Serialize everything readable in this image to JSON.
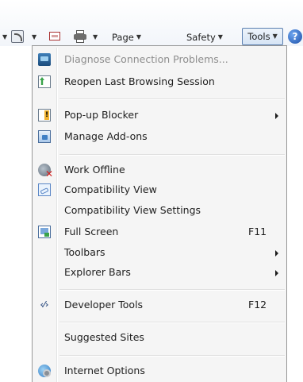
{
  "command_bar": {
    "page_label": "Page",
    "safety_label": "Safety",
    "tools_label": "Tools",
    "help_glyph": "?",
    "dropdown_caret": "▼",
    "icons": [
      "feeds-icon",
      "read-mail-icon",
      "print-icon",
      "help-icon"
    ]
  },
  "menu": {
    "items": {
      "diagnose": "Diagnose Connection Problems...",
      "reopen": "Reopen Last Browsing Session",
      "popup_blocker": "Pop-up Blocker",
      "manage_addons": "Manage Add-ons",
      "work_offline": "Work Offline",
      "compat_view": "Compatibility View",
      "compat_settings": "Compatibility View Settings",
      "full_screen": "Full Screen",
      "full_screen_key": "F11",
      "toolbars": "Toolbars",
      "explorer_bars": "Explorer Bars",
      "developer_tools": "Developer Tools",
      "developer_tools_key": "F12",
      "suggested_sites": "Suggested Sites",
      "internet_options": "Internet Options"
    },
    "dev_tools_glyph": "‹⁄›"
  },
  "colors": {
    "menu_background": "#f5f5f5",
    "menu_border": "#979797",
    "disabled_text": "#8d8d8d",
    "tools_button_border": "#5b7fb0"
  }
}
